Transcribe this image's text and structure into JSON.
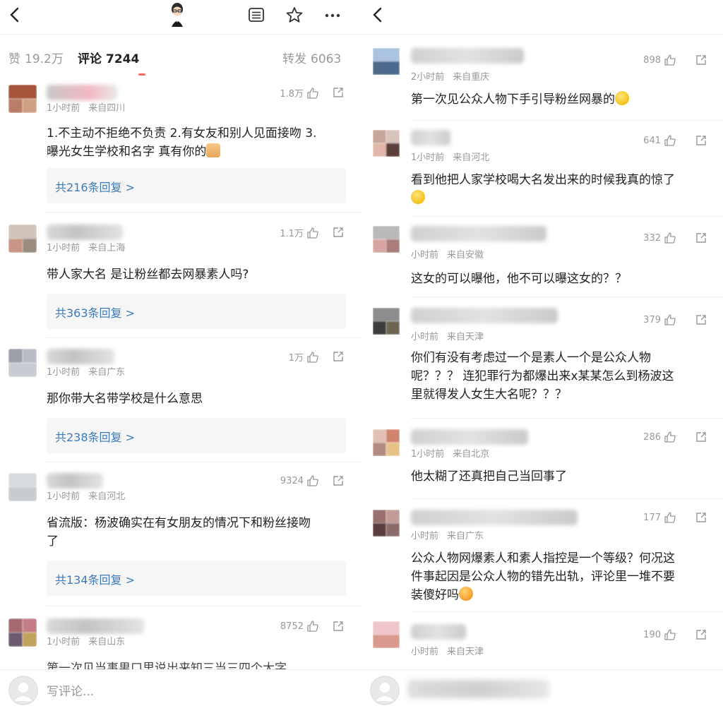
{
  "left": {
    "stats": {
      "likes_label": "赞",
      "likes_count": "19.2万",
      "comments_label": "评论",
      "comments_count": "7244",
      "reposts_label": "转发",
      "reposts_count": "6063"
    },
    "comments": [
      {
        "time": "1小时前",
        "location": "来自四川",
        "likes": "1.8万",
        "text_lines": [
          "1.不主动不拒绝不负责 2.有女友和别人见面接吻 3.",
          "曝光女生学校和名字 真有你的"
        ],
        "reply": "共216条回复 >"
      },
      {
        "time": "1小时前",
        "location": "来自上海",
        "likes": "1.1万",
        "text_lines": [
          "带人家大名 是让粉丝都去网暴素人吗?"
        ],
        "reply": "共363条回复 >"
      },
      {
        "time": "1小时前",
        "location": "来自广东",
        "likes": "1万",
        "text_lines": [
          "那你带大名带学校是什么意思"
        ],
        "reply": "共238条回复 >"
      },
      {
        "time": "1小时前",
        "location": "来自河北",
        "likes": "9324",
        "text_lines": [
          "省流版：杨波确实在有女朋友的情况下和粉丝接吻",
          "了"
        ],
        "reply": "共134条回复 >"
      },
      {
        "time": "1小时前",
        "location": "来自山东",
        "likes": "8752",
        "text_lines": [
          "第一次见当事男口里说出来知三当三四个大字"
        ]
      }
    ],
    "input_placeholder": "写评论..."
  },
  "right": {
    "comments": [
      {
        "time": "2小时前",
        "location": "来自重庆",
        "likes": "898",
        "text_lines": [
          "第一次见公众人物下手引导粉丝网暴的"
        ]
      },
      {
        "time": "1小时前",
        "location": "来自河北",
        "likes": "641",
        "text_lines": [
          "看到他把人家学校喝大名发出来的时候我真的惊了",
          ""
        ]
      },
      {
        "time": "小时前",
        "location": "来自安徽",
        "likes": "332",
        "text_lines": [
          "这女的可以曝他，他不可以曝这女的？？"
        ]
      },
      {
        "time": "小时前",
        "location": "来自天津",
        "likes": "379",
        "text_lines": [
          "你们有没有考虑过一个是素人一个是公众人物",
          "呢？？？ 连犯罪行为都爆出来x某某怎么到杨波这",
          "里就得发人女生大名呢？？？"
        ]
      },
      {
        "time": "1小时前",
        "location": "来自北京",
        "likes": "286",
        "text_lines": [
          "他太糊了还真把自己当回事了"
        ]
      },
      {
        "time": "小时前",
        "location": "来自广东",
        "likes": "177",
        "text_lines": [
          "公众人物网爆素人和素人指控是一个等级？何况这",
          "件事起因是公众人物的错先出轨，评论里一堆不要",
          "装傻好吗"
        ]
      },
      {
        "time": "小时前",
        "location": "来自天津",
        "likes": "190",
        "text_lines": []
      }
    ]
  },
  "icons": {
    "back": "chevron-left-icon",
    "menu": "list-icon",
    "star": "star-icon",
    "more": "more-icon",
    "like": "thumbs-up-icon",
    "share": "share-icon"
  },
  "colors": {
    "reply_link": "#3d7ab8",
    "meta_gray": "#999999",
    "reply_bg": "#f6f6f6"
  }
}
